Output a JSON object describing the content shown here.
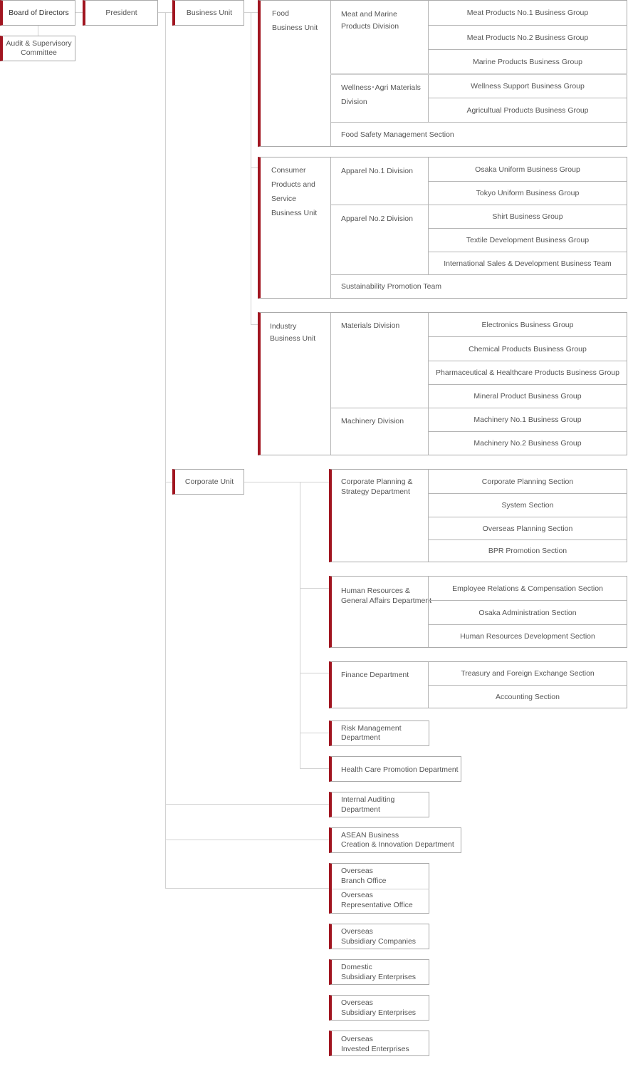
{
  "colors": {
    "accent": "#a11520",
    "border": "#aaaaaa",
    "connector": "#d2d2d2",
    "text": "#555555"
  },
  "top": {
    "board": "Board of Directors",
    "audit": [
      "Audit & Supervisory",
      "Committee"
    ],
    "president": "President",
    "business_unit": "Business Unit",
    "corporate_unit": "Corporate Unit"
  },
  "food": {
    "name": [
      "Food",
      "Business Unit"
    ],
    "divisions": [
      {
        "name": [
          "Meat and Marine",
          "Products Division"
        ],
        "groups": [
          "Meat Products No.1 Business Group",
          "Meat Products No.2 Business Group",
          "Marine Products Business Group"
        ]
      },
      {
        "name": [
          "Wellness･Agri Materials",
          "Division"
        ],
        "groups": [
          "Wellness Support Business Group",
          "Agricultual Products Business Group"
        ]
      }
    ],
    "section": "Food Safety Management Section"
  },
  "consumer": {
    "name": [
      "Consumer",
      "Products and",
      "Service",
      "Business Unit"
    ],
    "divisions": [
      {
        "name": "Apparel No.1 Division",
        "groups": [
          "Osaka Uniform Business Group",
          "Tokyo Uniform Business Group"
        ]
      },
      {
        "name": "Apparel No.2 Division",
        "groups": [
          "Shirt Business Group",
          "Textile Development Business Group",
          "International Sales & Development Business Team"
        ]
      }
    ],
    "section": "Sustainability Promotion Team"
  },
  "industry": {
    "name": [
      "Industry",
      "Business Unit"
    ],
    "divisions": [
      {
        "name": "Materials Division",
        "groups": [
          "Electronics Business Group",
          "Chemical Products Business Group",
          "Pharmaceutical & Healthcare Products Business Group",
          "Mineral Product Business Group"
        ]
      },
      {
        "name": "Machinery Division",
        "groups": [
          "Machinery No.1 Business Group",
          "Machinery No.2 Business Group"
        ]
      }
    ]
  },
  "corporate": {
    "planning": {
      "name": [
        "Corporate Planning &",
        "Strategy Department"
      ],
      "sections": [
        "Corporate Planning Section",
        "System Section",
        "Overseas Planning Section",
        "BPR Promotion Section"
      ]
    },
    "hr": {
      "name": [
        "Human Resources &",
        "General Affairs Department"
      ],
      "sections": [
        "Employee Relations & Compensation Section",
        "Osaka Administration Section",
        "Human Resources Development Section"
      ]
    },
    "finance": {
      "name": "Finance Department",
      "sections": [
        "Treasury and Foreign Exchange Section",
        "Accounting Section"
      ]
    },
    "risk": [
      "Risk Management",
      "Department"
    ],
    "health": "Health Care Promotion Department"
  },
  "others": {
    "internal_audit": [
      "Internal Auditing",
      "Department"
    ],
    "asean": [
      "ASEAN Business",
      "Creation & Innovation Department"
    ],
    "overseas_branch": [
      "Overseas",
      "Branch Office"
    ],
    "overseas_rep": [
      "Overseas",
      "Representative Office"
    ],
    "overseas_subsidiary_companies": [
      "Overseas",
      "Subsidiary Companies"
    ],
    "domestic_subsidiary": [
      "Domestic",
      "Subsidiary Enterprises"
    ],
    "overseas_subsidiary_enterprises": [
      "Overseas",
      "Subsidiary Enterprises"
    ],
    "overseas_invested": [
      "Overseas",
      "Invested Enterprises"
    ]
  }
}
